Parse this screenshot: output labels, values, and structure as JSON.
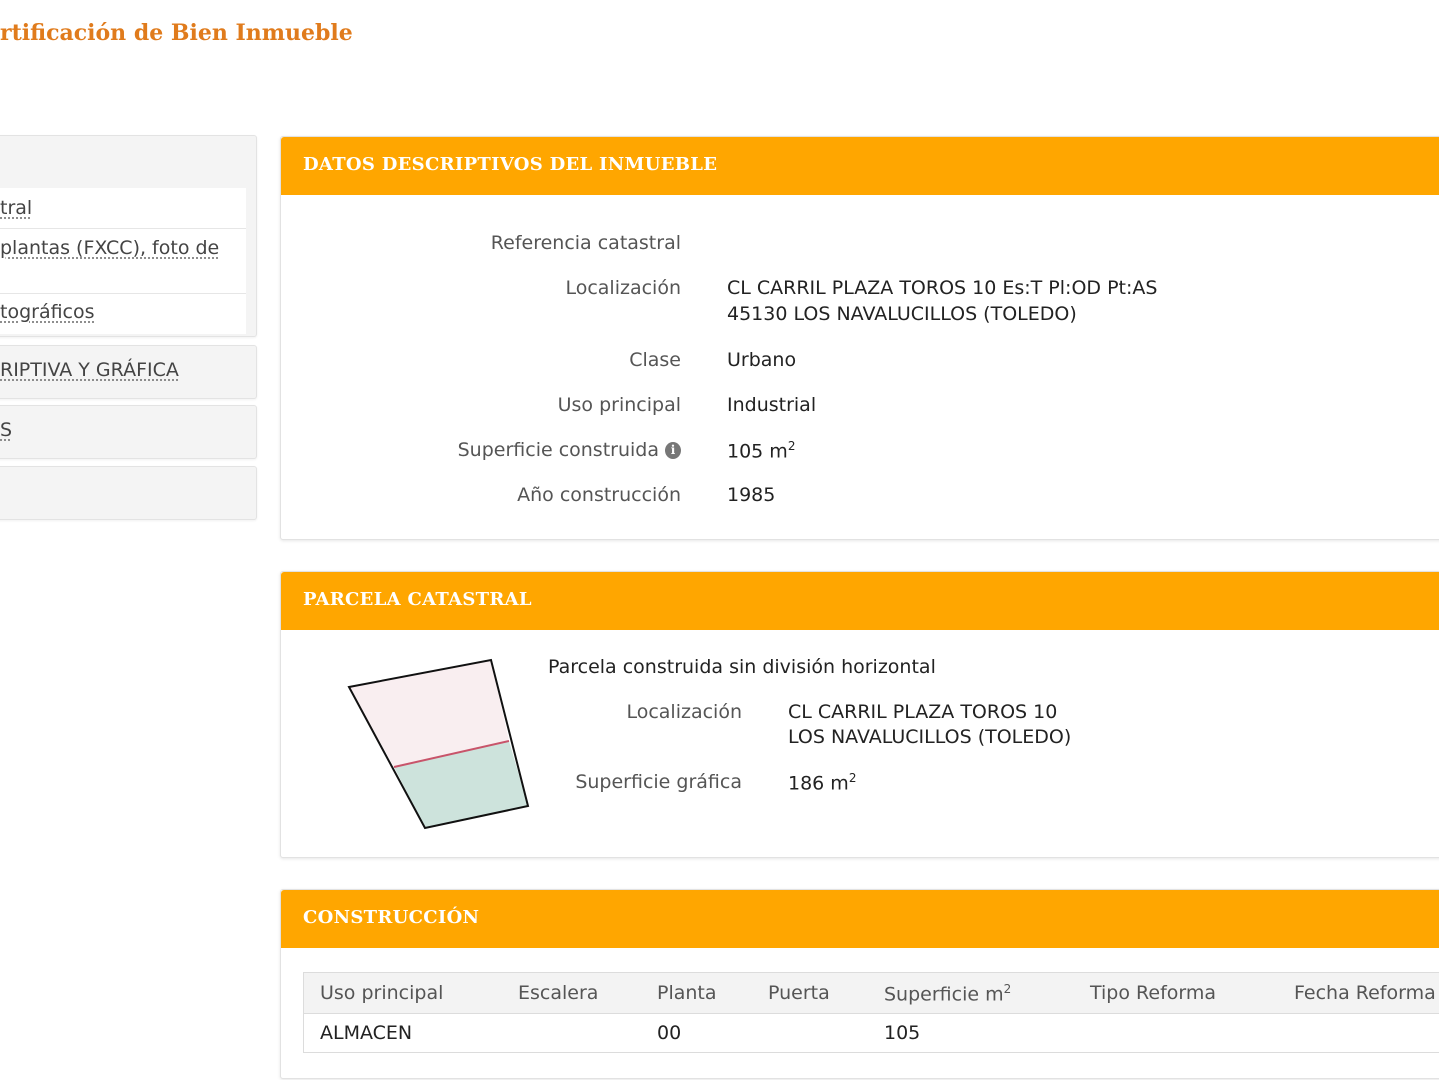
{
  "page": {
    "title": "ertificación de Bien Inmueble"
  },
  "sidebar": {
    "items": [
      {
        "label": "tral"
      },
      {
        "label": "plantas (FXCC), foto de"
      },
      {
        "label": "tográficos"
      },
      {
        "label": "RIPTIVA Y GRÁFICA"
      },
      {
        "label": "S"
      }
    ]
  },
  "datos": {
    "title": "DATOS DESCRIPTIVOS DEL INMUEBLE",
    "fields": [
      {
        "label": "Referencia catastral",
        "value": ""
      },
      {
        "label": "Localización",
        "value": "CL CARRIL PLAZA TOROS 10 Es:T Pl:OD Pt:AS",
        "value2": "45130 LOS NAVALUCILLOS (TOLEDO)"
      },
      {
        "label": "Clase",
        "value": "Urbano"
      },
      {
        "label": "Uso principal",
        "value": "Industrial"
      },
      {
        "label": "Superficie construida",
        "value": "105 m",
        "unit_sup": "2"
      },
      {
        "label": "Año construcción",
        "value": "1985"
      }
    ]
  },
  "parcela": {
    "title": "PARCELA CATASTRAL",
    "subtitle": "Parcela construida sin división horizontal",
    "fields": [
      {
        "label": "Localización",
        "value": "CL CARRIL PLAZA TOROS 10",
        "value2": "LOS NAVALUCILLOS (TOLEDO)"
      },
      {
        "label": "Superficie gráfica",
        "value": "186 m",
        "unit_sup": "2"
      }
    ],
    "colors": {
      "upper": "#f9eef0",
      "lower": "#cde3dc",
      "divider": "#c8546a",
      "outline": "#111111"
    }
  },
  "construccion": {
    "title": "CONSTRUCCIÓN",
    "columns": [
      "Uso principal",
      "Escalera",
      "Planta",
      "Puerta",
      "Superficie m",
      "Tipo Reforma",
      "Fecha Reforma"
    ],
    "superficie_sup": "2",
    "rows": [
      [
        "ALMACEN",
        "",
        "00",
        "",
        "105",
        "",
        ""
      ]
    ]
  },
  "colors": {
    "header": "#ffa600",
    "title": "#e07b1c"
  }
}
